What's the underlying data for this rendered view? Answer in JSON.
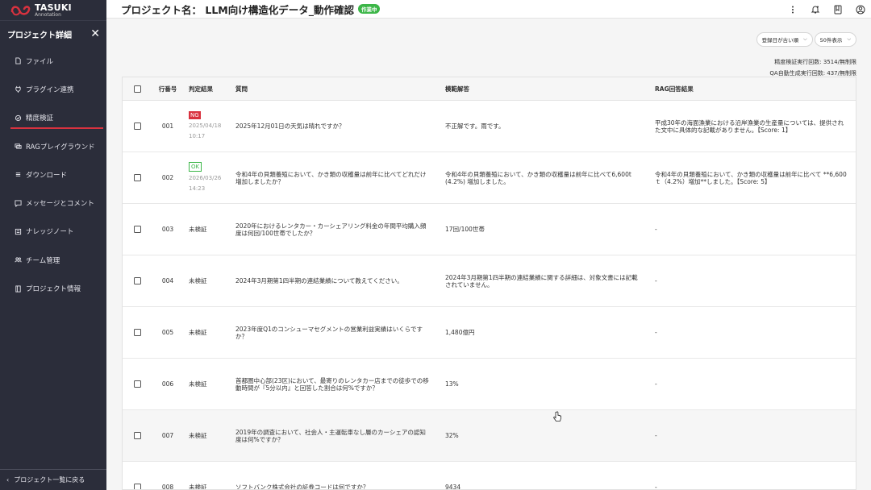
{
  "app": {
    "logo_main": "TASUKI",
    "logo_sub": "Annotation"
  },
  "sidebar": {
    "title": "プロジェクト詳細",
    "items": [
      {
        "label": "ファイル",
        "icon": "file-icon"
      },
      {
        "label": "プラグイン連携",
        "icon": "plugin-icon"
      },
      {
        "label": "精度検証",
        "icon": "accuracy-icon",
        "active": true
      },
      {
        "label": "RAGプレイグラウンド",
        "icon": "chat-icon"
      },
      {
        "label": "ダウンロード",
        "icon": "download-icon"
      },
      {
        "label": "メッセージとコメント",
        "icon": "message-icon"
      },
      {
        "label": "ナレッジノート",
        "icon": "note-icon"
      },
      {
        "label": "チーム管理",
        "icon": "team-icon"
      },
      {
        "label": "プロジェクト情報",
        "icon": "book-icon"
      }
    ],
    "footer": "プロジェクト一覧に戻る"
  },
  "header": {
    "title": "プロジェクト名： LLM向け構造化データ_動作確認",
    "status_badge": "作業中"
  },
  "controls": {
    "sort_label": "登録日が古い順",
    "page_size_label": "50件表示"
  },
  "counts": {
    "accuracy_runs": "精度検証実行回数: 3514/無制限",
    "qa_runs": "QA自動生成実行回数: 437/無制限"
  },
  "table": {
    "columns": [
      "行番号",
      "判定結果",
      "質問",
      "模範解答",
      "RAG回答結果"
    ],
    "rows": [
      {
        "no": "001",
        "tag": "NG",
        "date": "2025/04/18",
        "time": "10:17",
        "judge": "",
        "question": "2025年12月01日の天気は晴れですか？",
        "model_answer": "不正解です。雨です。",
        "rag": "平成30年の海面漁業における沿岸漁業の生産量については、提供された文中に具体的な記載がありません。【Score: 1】"
      },
      {
        "no": "002",
        "tag": "OK",
        "date": "2026/03/26",
        "time": "14:23",
        "judge": "",
        "question": "令和4年の貝類養殖において、かき類の収穫量は前年に比べてどれだけ増加しましたか？",
        "model_answer": "令和4年の貝類養殖において、かき類の収穫量は前年に比べて6,600t (4.2%) 増加しました。",
        "rag": "令和4年の貝類養殖において、かき類の収穫量は前年に比べて **6,600ｔ（4.2%）増加**しました。【Score: 5】"
      },
      {
        "no": "003",
        "tag": "",
        "date": "",
        "time": "",
        "judge": "未検証",
        "question": "2020年におけるレンタカー・カーシェアリング料金の年間平均購入頻度は何回/100世帯でしたか？",
        "model_answer": "17回/100世帯",
        "rag": "-"
      },
      {
        "no": "004",
        "tag": "",
        "date": "",
        "time": "",
        "judge": "未検証",
        "question": "2024年3月期第1四半期の連結業績について教えてください。",
        "model_answer": "2024年3月期第1四半期の連結業績に関する詳細は、対象文書には記載されていません。",
        "rag": "-"
      },
      {
        "no": "005",
        "tag": "",
        "date": "",
        "time": "",
        "judge": "未検証",
        "question": "2023年度Q1のコンシューマセグメントの営業利益実績はいくらですか？",
        "model_answer": "1,480億円",
        "rag": "-"
      },
      {
        "no": "006",
        "tag": "",
        "date": "",
        "time": "",
        "judge": "未検証",
        "question": "首都圏中心部(23区)において、最寄りのレンタカー店までの徒歩での移動時間が『5分以内』と回答した割合は何%ですか？",
        "model_answer": "13%",
        "rag": "-"
      },
      {
        "no": "007",
        "tag": "",
        "date": "",
        "time": "",
        "judge": "未検証",
        "question": "2019年の調査において、社会人・主運転車なし層のカーシェアの認知度は何%ですか？",
        "model_answer": "32%",
        "rag": "-"
      },
      {
        "no": "008",
        "tag": "",
        "date": "",
        "time": "",
        "judge": "未検証",
        "question": "ソフトバンク株式会社の証券コードは何ですか？",
        "model_answer": "9434",
        "rag": "-"
      }
    ]
  },
  "colors": {
    "sidebar_bg": "#2b2d3a",
    "accent_red": "#d9323f",
    "status_green": "#3cb648"
  }
}
